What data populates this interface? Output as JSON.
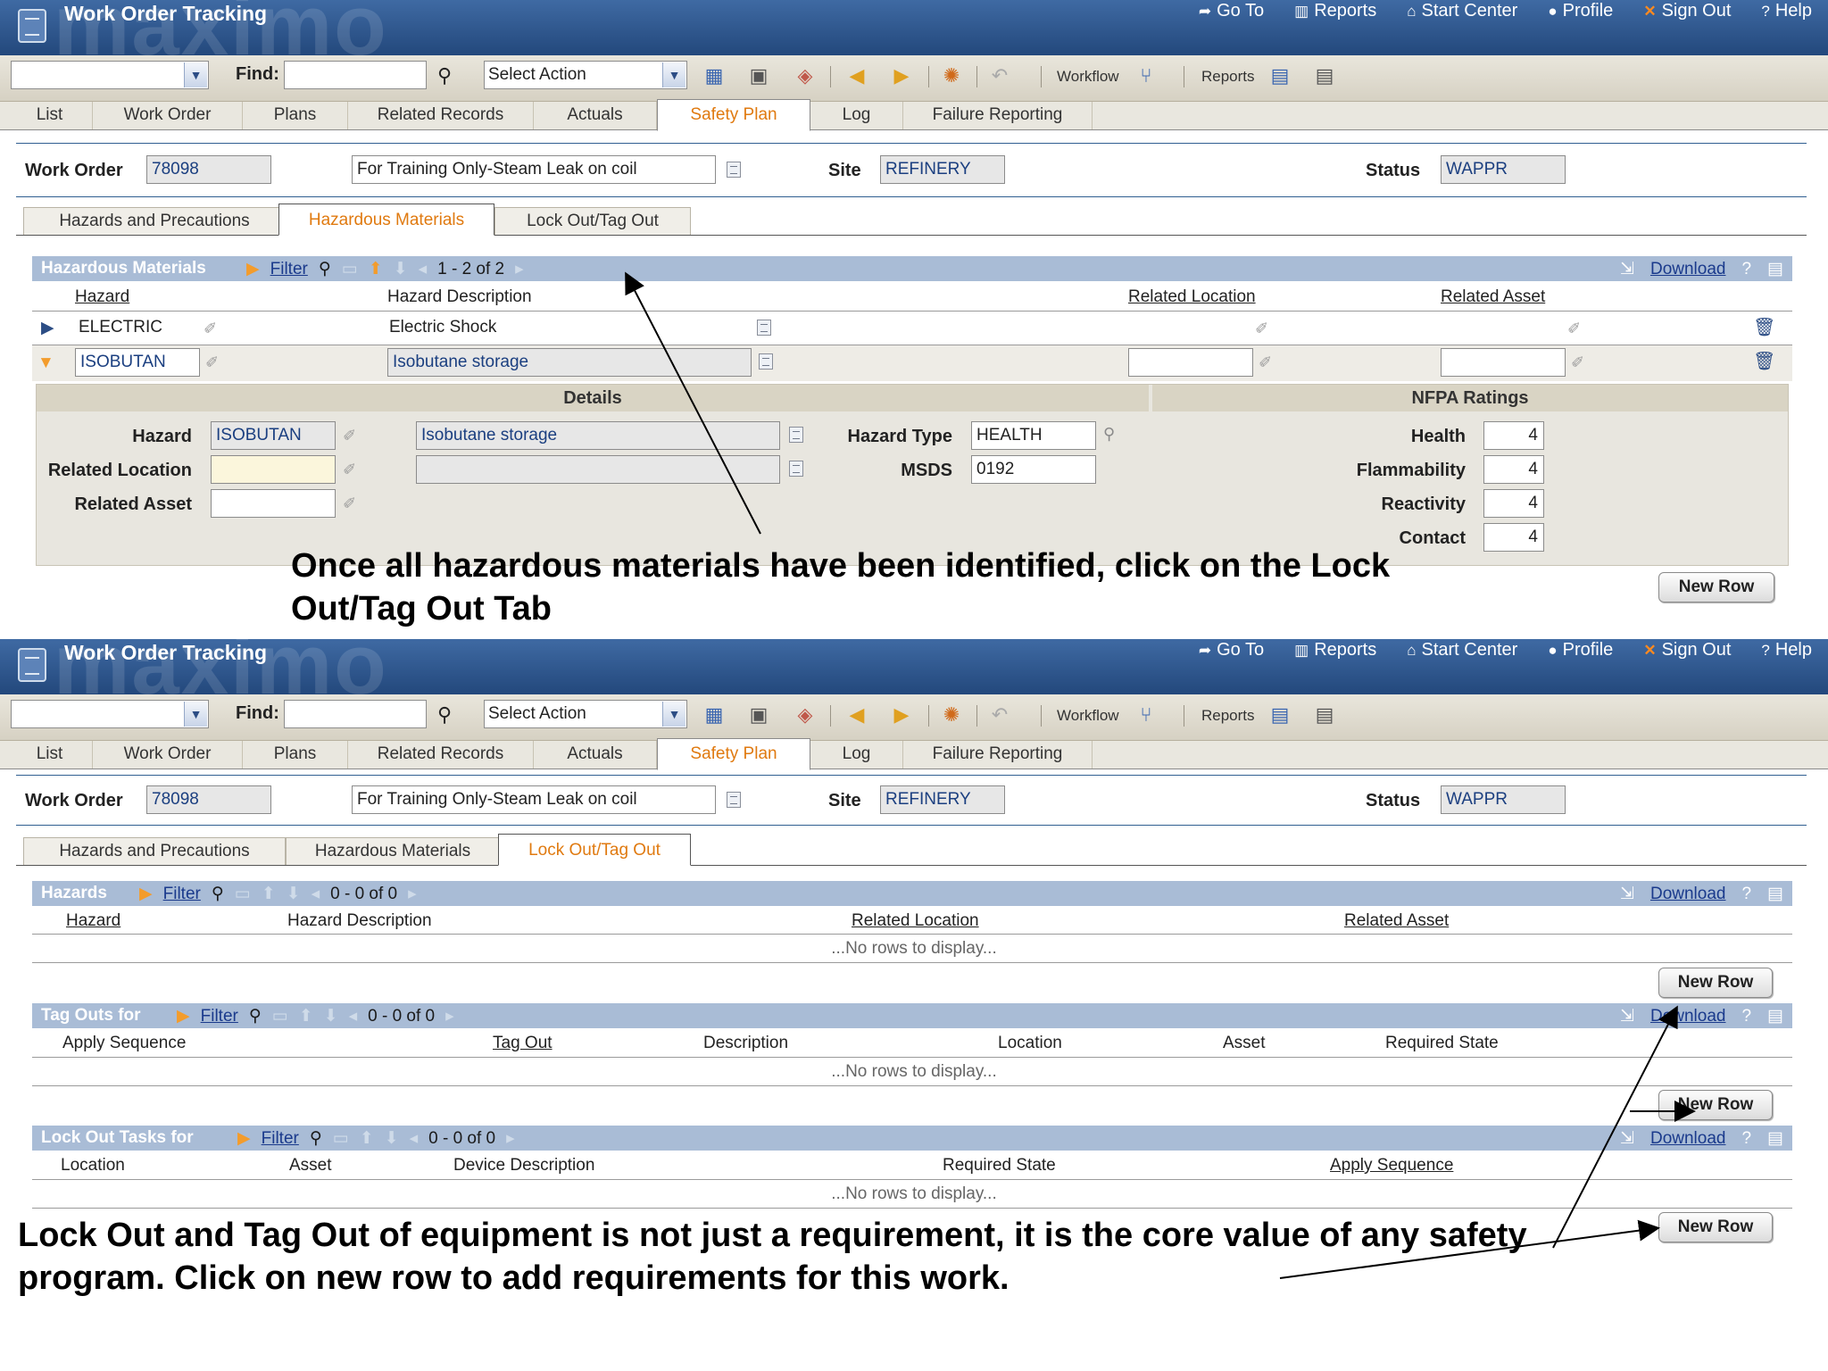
{
  "app": {
    "title": "Work Order Tracking",
    "watermark": "maximo",
    "links": [
      {
        "icon": "➦",
        "label": "Go To"
      },
      {
        "icon": "▥",
        "label": "Reports"
      },
      {
        "icon": "⌂",
        "label": "Start Center"
      },
      {
        "icon": "●",
        "label": "Profile"
      },
      {
        "icon": "✕",
        "label": "Sign Out"
      },
      {
        "icon": "?",
        "label": "Help"
      }
    ]
  },
  "toolbar": {
    "find_label": "Find:",
    "select_action": "Select Action",
    "workflow_label": "Workflow",
    "reports_label": "Reports"
  },
  "tabs": [
    "List",
    "Work Order",
    "Plans",
    "Related Records",
    "Actuals",
    "Safety Plan",
    "Log",
    "Failure Reporting"
  ],
  "header": {
    "work_order_label": "Work Order",
    "work_order": "78098",
    "description": "For Training Only-Steam Leak on coil",
    "site_label": "Site",
    "site": "REFINERY",
    "status_label": "Status",
    "status": "WAPPR"
  },
  "subtabs": [
    "Hazards and Precautions",
    "Hazardous Materials",
    "Lock Out/Tag Out"
  ],
  "common": {
    "filter": "Filter",
    "download": "Download",
    "help": "?",
    "new_row": "New Row",
    "no_rows": "...No rows to display..."
  },
  "top": {
    "section_title": "Hazardous Materials",
    "count": "1 - 2 of 2",
    "columns": [
      "Hazard",
      "Hazard Description",
      "Related Location",
      "Related Asset"
    ],
    "rows": [
      {
        "hazard": "ELECTRIC",
        "description": "Electric Shock"
      },
      {
        "hazard": "ISOBUTAN",
        "description": "Isobutane storage"
      }
    ],
    "details": {
      "title": "Details",
      "nfpa_title": "NFPA Ratings",
      "hazard_label": "Hazard",
      "hazard": "ISOBUTAN",
      "hazard_desc": "Isobutane storage",
      "related_location_label": "Related Location",
      "related_asset_label": "Related Asset",
      "hazard_type_label": "Hazard Type",
      "hazard_type": "HEALTH",
      "msds_label": "MSDS",
      "msds": "0192",
      "health_label": "Health",
      "health": "4",
      "flammability_label": "Flammability",
      "flammability": "4",
      "reactivity_label": "Reactivity",
      "reactivity": "4",
      "contact_label": "Contact",
      "contact": "4"
    },
    "caption": "Once all hazardous materials have been identified, click on the Lock Out/Tag Out Tab"
  },
  "bottom": {
    "hazards": {
      "title": "Hazards",
      "count": "0 - 0 of 0",
      "columns": [
        "Hazard",
        "Hazard Description",
        "Related Location",
        "Related Asset"
      ]
    },
    "tagouts": {
      "title": "Tag Outs for",
      "count": "0 - 0 of 0",
      "columns": [
        "Apply Sequence",
        "Tag Out",
        "Description",
        "Location",
        "Asset",
        "Required State"
      ]
    },
    "lockouts": {
      "title": "Lock Out Tasks for",
      "count": "0 - 0 of 0",
      "columns": [
        "Location",
        "Asset",
        "Device Description",
        "Required State",
        "Apply Sequence"
      ]
    },
    "caption": "Lock Out and Tag Out of equipment is not just a requirement, it is the core value of any safety program. Click on new row to add requirements for this work."
  },
  "colors": {
    "titlebar": "#2f5a92",
    "section_bar": "#a9bcd6",
    "active_tab": "#e07a10"
  }
}
